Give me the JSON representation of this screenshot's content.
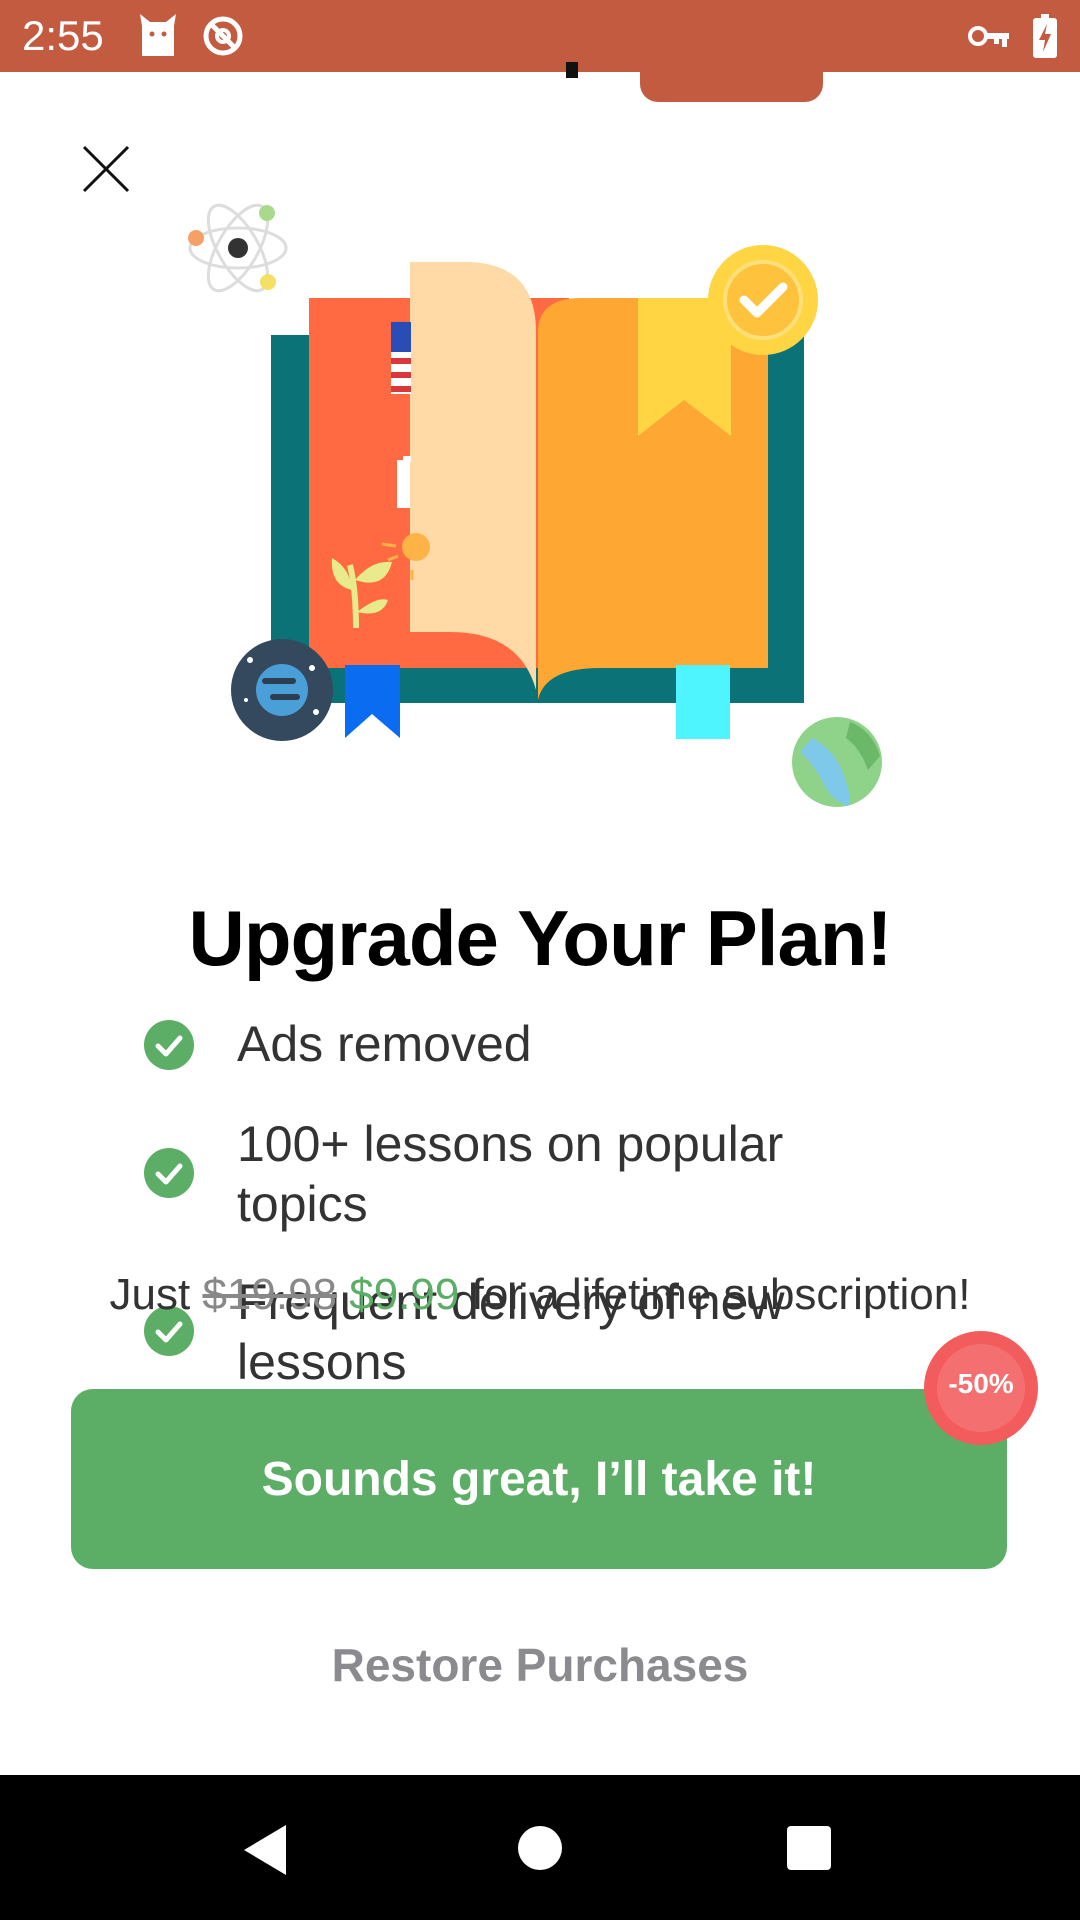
{
  "status_bar": {
    "time": "2:55",
    "background_color": "#c35b41",
    "left_icons": [
      "cat-icon",
      "blocked-icon"
    ],
    "right_icons": [
      "vpn-key-icon",
      "battery-charging-icon"
    ]
  },
  "close_icon": "close-icon",
  "illustration_icons": [
    "atom-icon",
    "book-icon",
    "badge-check-icon",
    "flag-icon",
    "plant-icon",
    "planet-icon",
    "globe-icon"
  ],
  "headline": "Upgrade Your Plan!",
  "features": [
    {
      "label": "Ads removed"
    },
    {
      "label": "100+ lessons on popular topics"
    },
    {
      "label": "Frequent delivery of new lessons"
    }
  ],
  "offer": {
    "prefix": "Just",
    "old_price": "$19.98",
    "new_price": "$9.99",
    "suffix": "for a lifetime subscription!"
  },
  "cta_button": {
    "label": "Sounds great, I’ll take it!",
    "color": "#5cae67"
  },
  "discount_badge": {
    "label": "-50%",
    "color": "#f25c5c"
  },
  "restore_link": "Restore Purchases",
  "nav_bar": {
    "buttons": [
      "back-icon",
      "home-icon",
      "recents-icon"
    ]
  }
}
